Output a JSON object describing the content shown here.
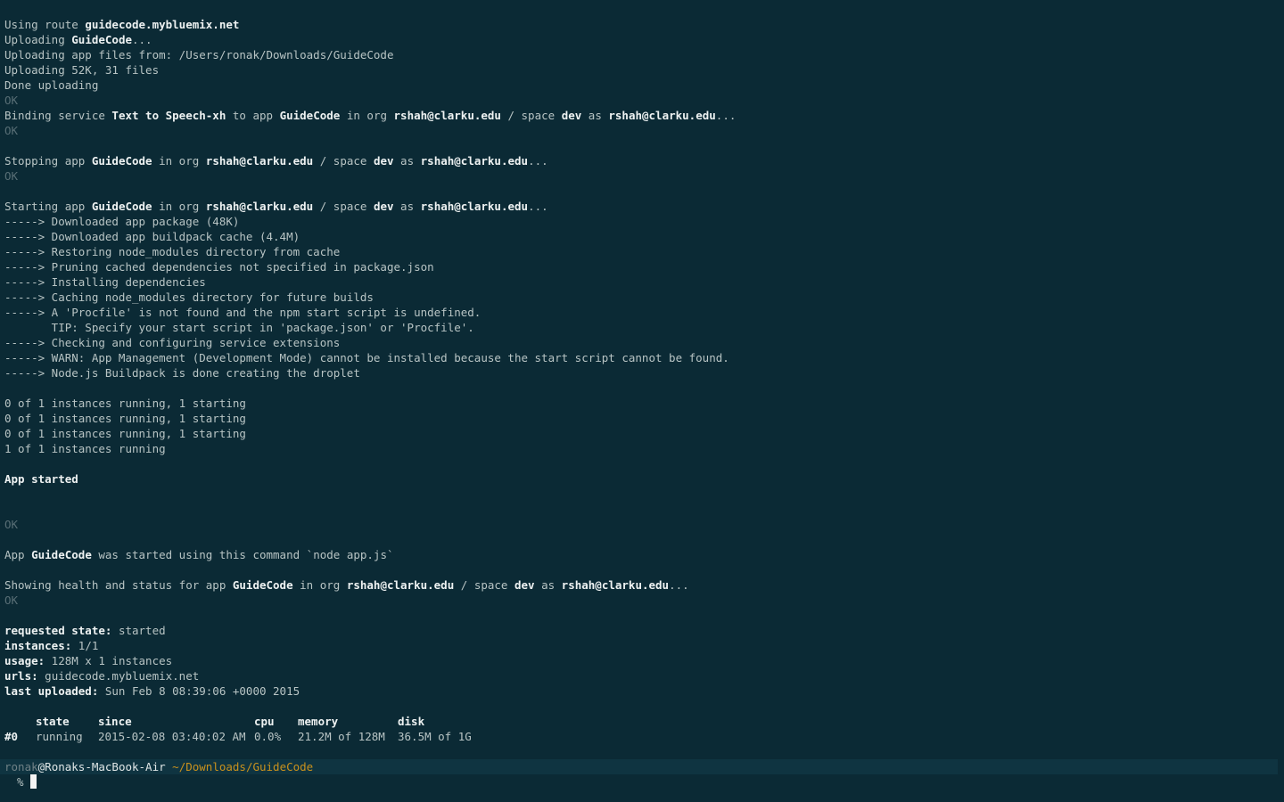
{
  "output": {
    "route": [
      "Using route ",
      "guidecode.mybluemix.net"
    ],
    "uploading_app": [
      "Uploading ",
      "GuideCode",
      "..."
    ],
    "upload_from": "Uploading app files from: /Users/ronak/Downloads/GuideCode",
    "upload_size": "Uploading 52K, 31 files",
    "done_uploading": "Done uploading",
    "ok": "OK",
    "binding": [
      "Binding service ",
      "Text to Speech-xh",
      " to app ",
      "GuideCode",
      " in org ",
      "rshah@clarku.edu",
      " / space ",
      "dev",
      " as ",
      "rshah@clarku.edu",
      "..."
    ],
    "stopping": [
      "Stopping app ",
      "GuideCode",
      " in org ",
      "rshah@clarku.edu",
      " / space ",
      "dev",
      " as ",
      "rshah@clarku.edu",
      "..."
    ],
    "starting": [
      "Starting app ",
      "GuideCode",
      " in org ",
      "rshah@clarku.edu",
      " / space ",
      "dev",
      " as ",
      "rshah@clarku.edu",
      "..."
    ],
    "buildpack_log": [
      "-----> Downloaded app package (48K)",
      "-----> Downloaded app buildpack cache (4.4M)",
      "-----> Restoring node_modules directory from cache",
      "-----> Pruning cached dependencies not specified in package.json",
      "-----> Installing dependencies",
      "-----> Caching node_modules directory for future builds",
      "-----> A 'Procfile' is not found and the npm start script is undefined.",
      "       TIP: Specify your start script in 'package.json' or 'Procfile'.",
      "-----> Checking and configuring service extensions",
      "-----> WARN: App Management (Development Mode) cannot be installed because the start script cannot be found.",
      "-----> Node.js Buildpack is done creating the droplet"
    ],
    "instances_log": [
      "0 of 1 instances running, 1 starting",
      "0 of 1 instances running, 1 starting",
      "0 of 1 instances running, 1 starting",
      "1 of 1 instances running"
    ],
    "app_started": "App started",
    "start_command": [
      "App ",
      "GuideCode",
      " was started using this command `node app.js`"
    ],
    "health": [
      "Showing health and status for app ",
      "GuideCode",
      " in org ",
      "rshah@clarku.edu",
      " / space ",
      "dev",
      " as ",
      "rshah@clarku.edu",
      "..."
    ],
    "status": {
      "requested_state_label": "requested state:",
      "requested_state_value": " started",
      "instances_label": "instances:",
      "instances_value": " 1/1",
      "usage_label": "usage:",
      "usage_value": " 128M x 1 instances",
      "urls_label": "urls:",
      "urls_value": " guidecode.mybluemix.net",
      "last_uploaded_label": "last uploaded:",
      "last_uploaded_value": " Sun Feb 8 08:39:06 +0000 2015"
    },
    "instance_table": {
      "headers": [
        "state",
        "since",
        "cpu",
        "memory",
        "disk"
      ],
      "row": {
        "index": "#0",
        "state": "running",
        "since": "2015-02-08 03:40:02 AM",
        "cpu": "0.0%",
        "memory": "21.2M of 128M",
        "disk": "36.5M of 1G"
      }
    }
  },
  "prompt": {
    "user": "ronak",
    "host": "@Ronaks-MacBook-Air",
    "path": "~/Downloads/GuideCode",
    "symbol": "%"
  },
  "colors": {
    "background": "#0b2a35",
    "text": "#b8c4c4",
    "bold_text": "#eef2f2",
    "dim_text": "#586e75",
    "path": "#c9911d"
  }
}
